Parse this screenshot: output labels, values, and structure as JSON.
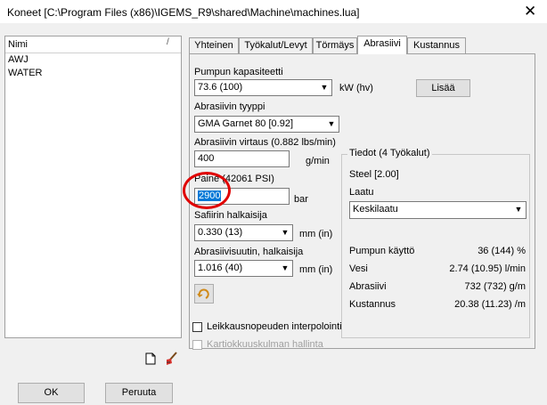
{
  "window": {
    "title": "Koneet  [C:\\Program Files (x86)\\IGEMS_R9\\shared\\Machine\\machines.lua]",
    "close_glyph": "✕"
  },
  "list": {
    "header": "Nimi",
    "sort_glyph": "/",
    "items": [
      "AWJ",
      "WATER"
    ]
  },
  "tabs": [
    "Yhteinen",
    "Työkalut/Levyt",
    "Törmäys",
    "Abrasiivi",
    "Kustannus"
  ],
  "form": {
    "pump_label": "Pumpun kapasiteetti",
    "pump_value": "73.6 (100)",
    "pump_unit": "kW (hv)",
    "add_button": "Lisää",
    "abrasive_type_label": "Abrasiivin tyyppi",
    "abrasive_type_value": "GMA Garnet 80 [0.92]",
    "flow_label": "Abrasiivin virtaus (0.882 lbs/min)",
    "flow_value": "400",
    "flow_unit": "g/min",
    "pressure_label": "Paine (42061 PSI)",
    "pressure_value": "2900",
    "pressure_unit": "bar",
    "orifice_label": "Safiirin halkaisija",
    "orifice_value": "0.330 (13)",
    "orifice_unit": "mm (in)",
    "nozzle_label": "Abrasiivisuutin, halkaisija",
    "nozzle_value": "1.016 (40)",
    "nozzle_unit": "mm (in)"
  },
  "info": {
    "group_title": "Tiedot (4 Työkalut)",
    "material": "Steel [2.00]",
    "quality_label": "Laatu",
    "quality_value": "Keskilaatu",
    "rows": [
      {
        "label": "Pumpun käyttö",
        "value": "36 (144) %"
      },
      {
        "label": "Vesi",
        "value": "2.74 (10.95) l/min"
      },
      {
        "label": "Abrasiivi",
        "value": "732 (732) g/m"
      },
      {
        "label": "Kustannus",
        "value": "20.38 (11.23) /m"
      }
    ]
  },
  "options": {
    "interp_label": "Leikkausnopeuden interpolointi",
    "taper_label": "Kartiokkuuskulman hallinta"
  },
  "buttons": {
    "ok": "OK",
    "cancel": "Peruuta"
  },
  "colors": {
    "highlight": "#e00000",
    "selection": "#0078d7"
  }
}
